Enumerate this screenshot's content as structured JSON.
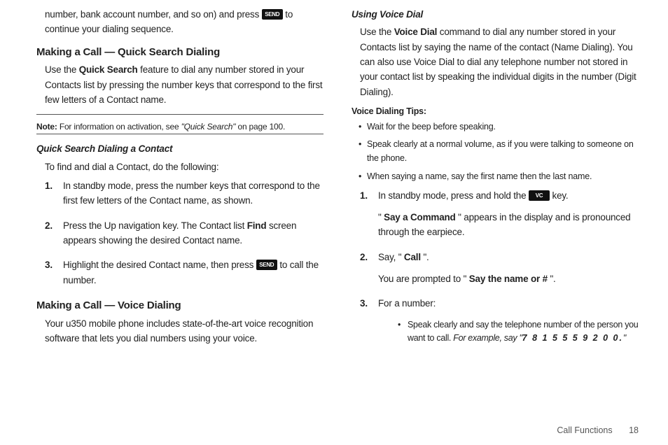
{
  "left": {
    "continuation": {
      "pre": "number, bank account number, and so on) and press ",
      "send_icon": "SEND",
      "post": " to continue your dialing sequence."
    },
    "h_quick_search": "Making a Call — Quick Search Dialing",
    "quick_search_para": {
      "pre": "Use the ",
      "bold": "Quick Search",
      "post": " feature to dial any number stored in your Contacts list by pressing the number keys that correspond to the first few letters of a Contact name."
    },
    "note": {
      "label": "Note:",
      "pre": " For information on activation, see ",
      "ref": "\"Quick Search\"",
      "post": " on page 100."
    },
    "h_qs_contact": "Quick Search Dialing a Contact",
    "qs_contact_lead": "To find and dial a Contact, do the following:",
    "qs_steps": [
      "In standby mode, press the number keys that correspond to the first few letters of the Contact name, as shown.",
      {
        "pre": "Press the Up navigation key. The Contact list ",
        "bold": "Find",
        "post": " screen appears showing the desired Contact name."
      },
      {
        "pre": "Highlight the desired Contact name, then press ",
        "icon": "SEND",
        "post": " to call the number."
      }
    ],
    "h_voice": "Making a Call — Voice Dialing",
    "voice_para": "Your u350 mobile phone includes state-of-the-art voice recognition software that lets you dial numbers using your voice."
  },
  "right": {
    "h_using_vd": "Using Voice Dial",
    "vd_para": {
      "pre": "Use the ",
      "bold": "Voice Dial",
      "post": " command to dial any number stored in your Contacts list by saying the name of the contact (Name Dialing). You can also use Voice Dial to dial any telephone number not stored in your contact list by speaking the individual digits in the number (Digit Dialing)."
    },
    "h_tips": "Voice Dialing Tips:",
    "tips": [
      "Wait for the beep before speaking.",
      "Speak clearly at a normal volume, as if you were talking to someone on the phone.",
      "When saying a name, say the first name then the last name."
    ],
    "steps": {
      "s1": {
        "pre": "In standby mode, press and hold the ",
        "icon": "VC",
        "post": " key.",
        "line2_pre": "\"",
        "line2_bold": "Say a Command",
        "line2_post": "\" appears in the display and is pronounced through the earpiece."
      },
      "s2": {
        "pre": "Say, \"",
        "bold": "Call",
        "post": "\".",
        "line2_pre": "You are prompted to \"",
        "line2_bold": "Say the name or #",
        "line2_post": "\"."
      },
      "s3": {
        "text": "For a number:",
        "sub_pre": "Speak clearly and say the telephone number of the person you want to call. ",
        "sub_example_pre": "For example, say \"",
        "sub_example_bold": "7 8 1 5 5 5 9 2 0 0.",
        "sub_example_post": "\""
      }
    }
  },
  "footer": {
    "section": "Call Functions",
    "page": "18"
  }
}
